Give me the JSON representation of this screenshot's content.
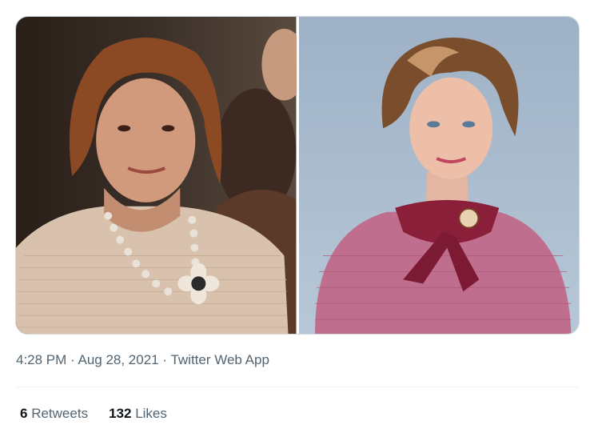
{
  "tweet": {
    "images": [
      {
        "name": "photo-left"
      },
      {
        "name": "photo-right"
      }
    ],
    "meta": {
      "time": "4:28 PM",
      "separator1": " · ",
      "date": "Aug 28, 2021",
      "separator2": " · ",
      "source": "Twitter Web App"
    },
    "stats": {
      "retweets_count": "6",
      "retweets_label": "Retweets",
      "likes_count": "132",
      "likes_label": "Likes"
    }
  },
  "colors": {
    "muted_text": "#536471",
    "primary_text": "#0f1419",
    "divider": "#eff3f4"
  }
}
